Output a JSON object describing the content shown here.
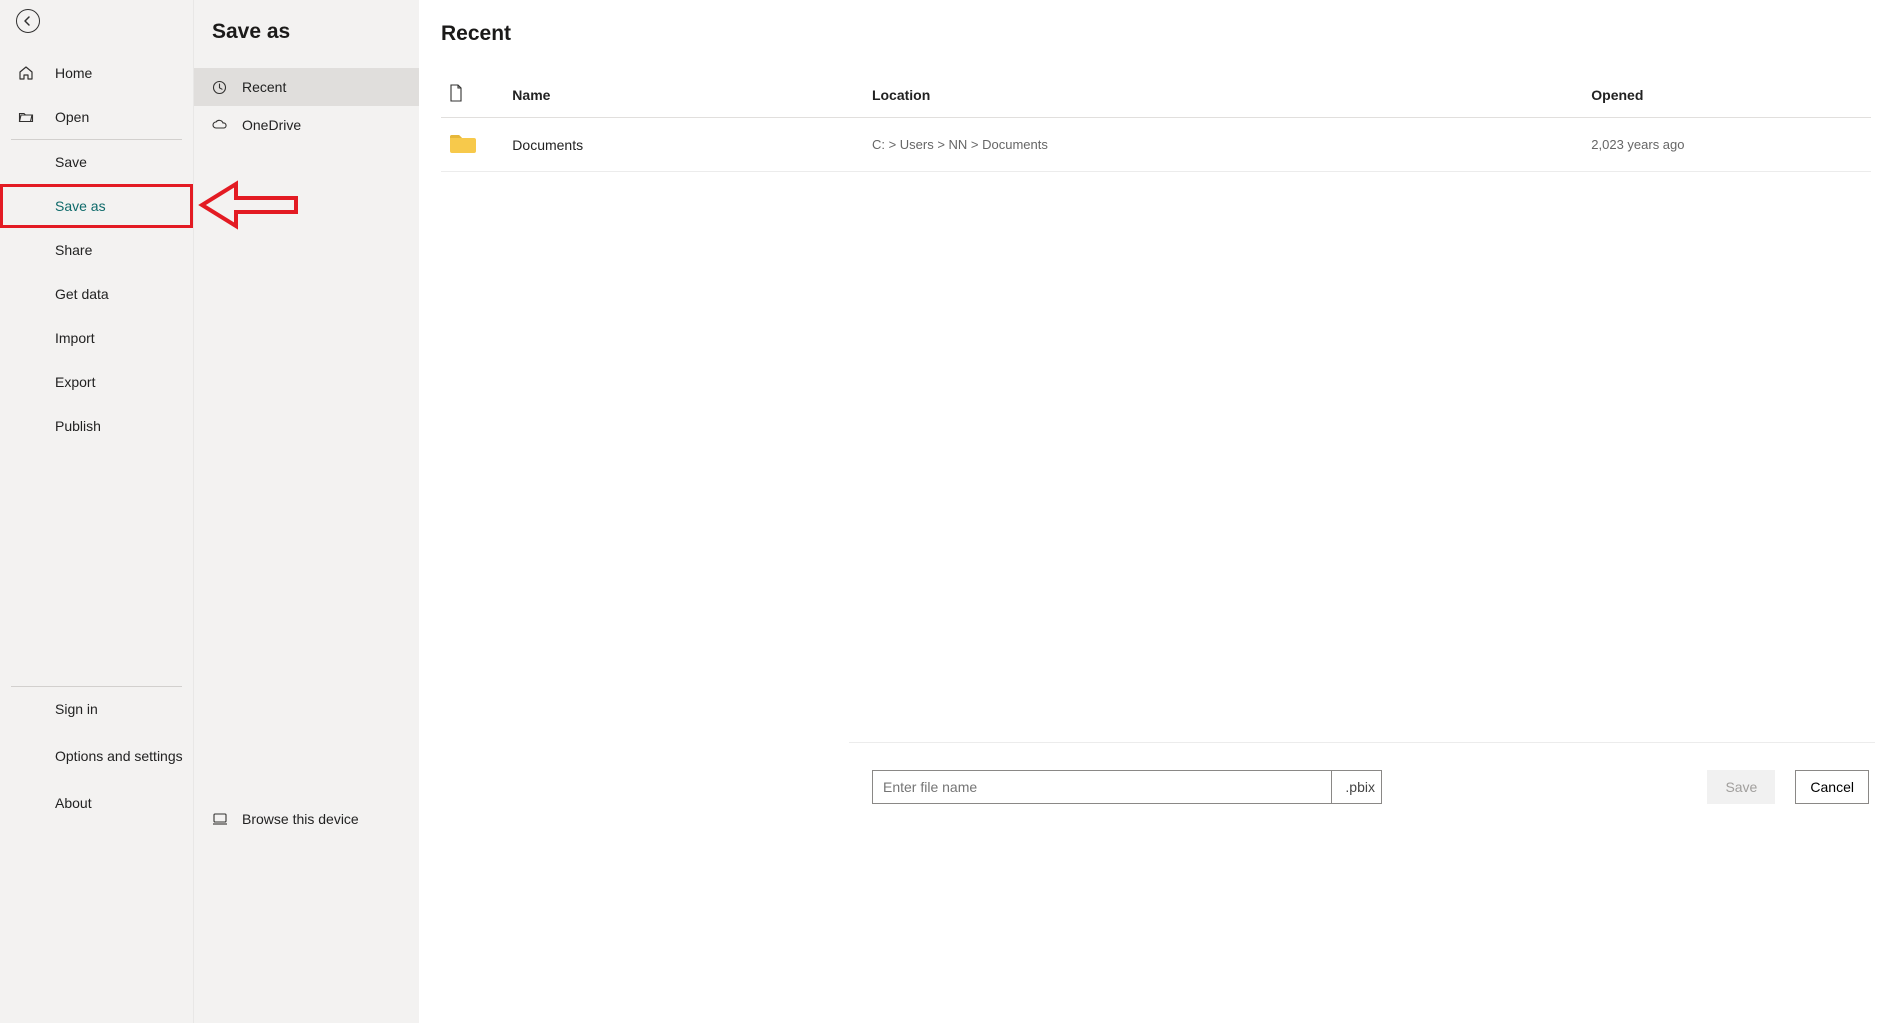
{
  "sidebar": {
    "items": [
      {
        "label": "Home",
        "icon": "home"
      },
      {
        "label": "Open",
        "icon": "folder-open"
      },
      {
        "label": "Save"
      },
      {
        "label": "Save as",
        "highlight": true
      },
      {
        "label": "Share"
      },
      {
        "label": "Get data"
      },
      {
        "label": "Import"
      },
      {
        "label": "Export"
      },
      {
        "label": "Publish"
      }
    ],
    "bottom": [
      {
        "label": "Sign in"
      },
      {
        "label": "Options and settings"
      },
      {
        "label": "About"
      }
    ]
  },
  "panel": {
    "title": "Save as",
    "locations": [
      {
        "label": "Recent",
        "icon": "clock",
        "selected": true
      },
      {
        "label": "OneDrive",
        "icon": "cloud"
      }
    ],
    "browse_label": "Browse this device"
  },
  "main": {
    "title": "Recent",
    "columns": {
      "name": "Name",
      "location": "Location",
      "opened": "Opened"
    },
    "rows": [
      {
        "name": "Documents",
        "location": "C:  >  Users  >  NN  >  Documents",
        "opened": "2,023 years ago",
        "icon": "folder"
      }
    ],
    "filename": {
      "placeholder": "Enter file name",
      "value": "",
      "ext": ".pbix"
    },
    "actions": {
      "save": "Save",
      "cancel": "Cancel"
    }
  }
}
